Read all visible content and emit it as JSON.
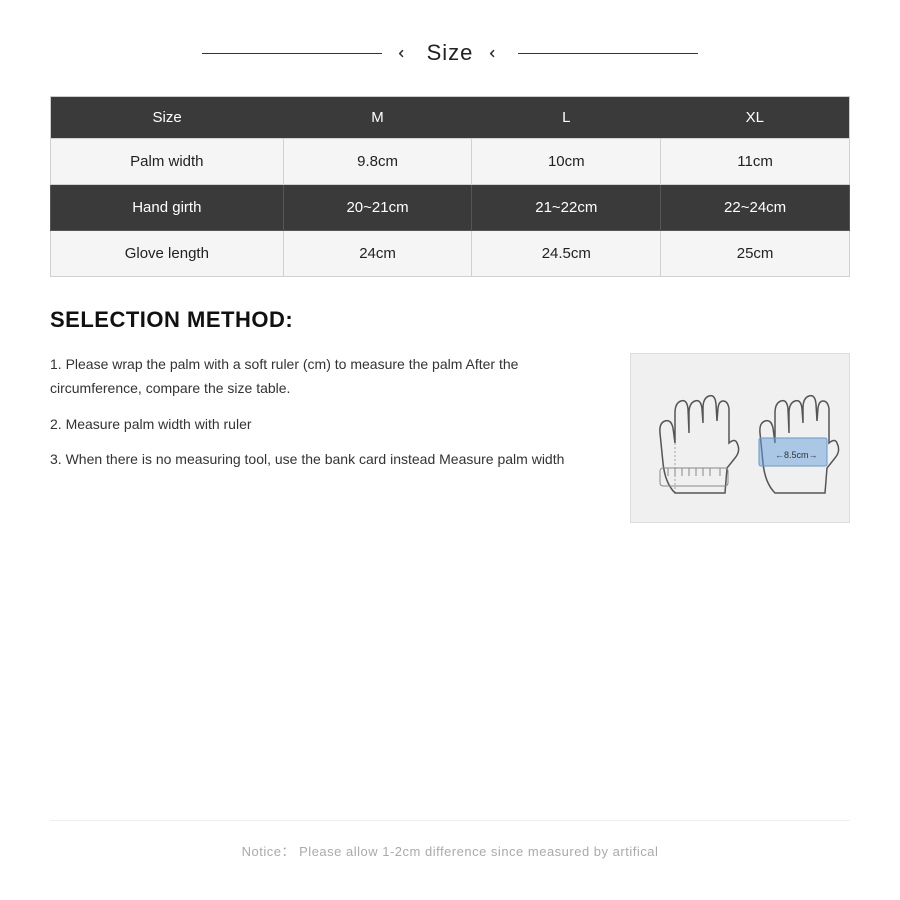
{
  "header": {
    "title": "Size",
    "chevron_left": "❯",
    "chevron_right": "❯"
  },
  "table": {
    "headers": [
      "Size",
      "M",
      "L",
      "XL"
    ],
    "rows": [
      {
        "label": "Palm width",
        "m": "9.8cm",
        "l": "10cm",
        "xl": "11cm",
        "style": "light"
      },
      {
        "label": "Hand girth",
        "m": "20~21cm",
        "l": "21~22cm",
        "xl": "22~24cm",
        "style": "dark"
      },
      {
        "label": "Glove length",
        "m": "24cm",
        "l": "24.5cm",
        "xl": "25cm",
        "style": "light"
      }
    ]
  },
  "selection": {
    "title": "SELECTION METHOD:",
    "steps": [
      "1. Please wrap the palm with a soft ruler (cm) to measure the palm After the circumference, compare the size table.",
      "2. Measure palm width with ruler",
      "3. When there is no measuring tool, use the bank card instead Measure palm width"
    ]
  },
  "notice": {
    "text": "Notice： Please allow 1-2cm difference since measured by artifical"
  }
}
